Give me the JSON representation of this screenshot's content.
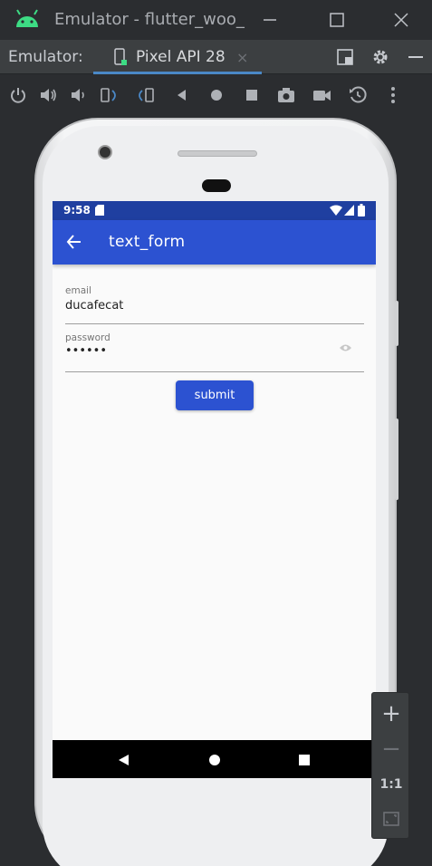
{
  "window": {
    "title": "Emulator - flutter_woo_",
    "minimize_icon": "minimize-icon",
    "maximize_icon": "maximize-icon",
    "close_icon": "close-icon"
  },
  "tabbar": {
    "label": "Emulator:",
    "tab_label": "Pixel API 28",
    "tab_close": "×"
  },
  "toolbar": {
    "icons": [
      "power-icon",
      "volume-up-icon",
      "volume-down-icon",
      "rotate-left-icon",
      "rotate-right-icon",
      "back-icon",
      "home-icon",
      "overview-icon",
      "screenshot-icon",
      "screen-record-icon",
      "snapshot-icon",
      "more-icon"
    ]
  },
  "phone": {
    "status": {
      "time": "9:58"
    },
    "appbar": {
      "title": "text_form"
    },
    "form": {
      "email_label": "email",
      "email_value": "ducafecat",
      "password_label": "password",
      "password_value": "••••••",
      "submit_label": "submit"
    }
  },
  "zoom": {
    "plus": "+",
    "minus": "−",
    "one_to_one": "1:1"
  },
  "colors": {
    "app_bar": "#2c52d1",
    "status_bar": "#1f3fa0",
    "ide_background": "#2b2d30",
    "tab_underline": "#4a88c7"
  }
}
